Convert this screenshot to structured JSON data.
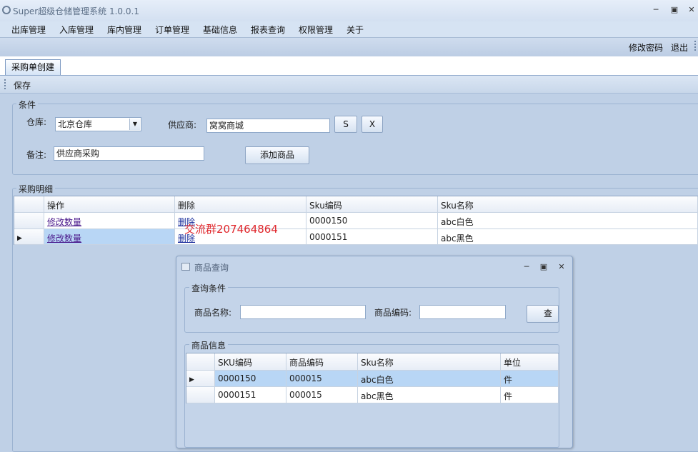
{
  "window": {
    "title": "Super超级仓储管理系统 1.0.0.1",
    "controls": [
      "minimize-icon",
      "maximize-icon",
      "close-icon"
    ]
  },
  "menu": [
    "出库管理",
    "入库管理",
    "库内管理",
    "订单管理",
    "基础信息",
    "报表查询",
    "权限管理",
    "关于"
  ],
  "top_links": {
    "change_password": "修改密码",
    "logout": "退出"
  },
  "tab": {
    "label": "采购单创建"
  },
  "toolbar": {
    "save_label": "保存"
  },
  "conditions": {
    "title": "条件",
    "warehouse_label": "仓库:",
    "warehouse_value": "北京仓库",
    "supplier_label": "供应商:",
    "supplier_value": "窝窝商城",
    "search_label": "S",
    "clear_label": "X",
    "note_label": "备注:",
    "note_value": "供应商采购",
    "add_product_label": "添加商品"
  },
  "details": {
    "title": "采购明细",
    "columns": [
      "操作",
      "删除",
      "Sku编码",
      "Sku名称"
    ],
    "rows": [
      {
        "action": "修改数量",
        "delete": "删除",
        "sku_code": "0000150",
        "sku_name": "abc白色"
      },
      {
        "action": "修改数量",
        "delete": "删除",
        "sku_code": "0000151",
        "sku_name": "abc黑色"
      }
    ]
  },
  "watermark": "交流群207464864",
  "dialog": {
    "title": "商品查询",
    "query_group": "查询条件",
    "name_label": "商品名称:",
    "name_value": "",
    "code_label": "商品编码:",
    "code_value": "",
    "query_button": "查",
    "info_group": "商品信息",
    "columns": [
      "SKU编码",
      "商品编码",
      "Sku名称",
      "单位"
    ],
    "rows": [
      {
        "sku": "0000150",
        "code": "000015",
        "name": "abc白色",
        "unit": "件"
      },
      {
        "sku": "0000151",
        "code": "000015",
        "name": "abc黑色",
        "unit": "件"
      }
    ]
  }
}
